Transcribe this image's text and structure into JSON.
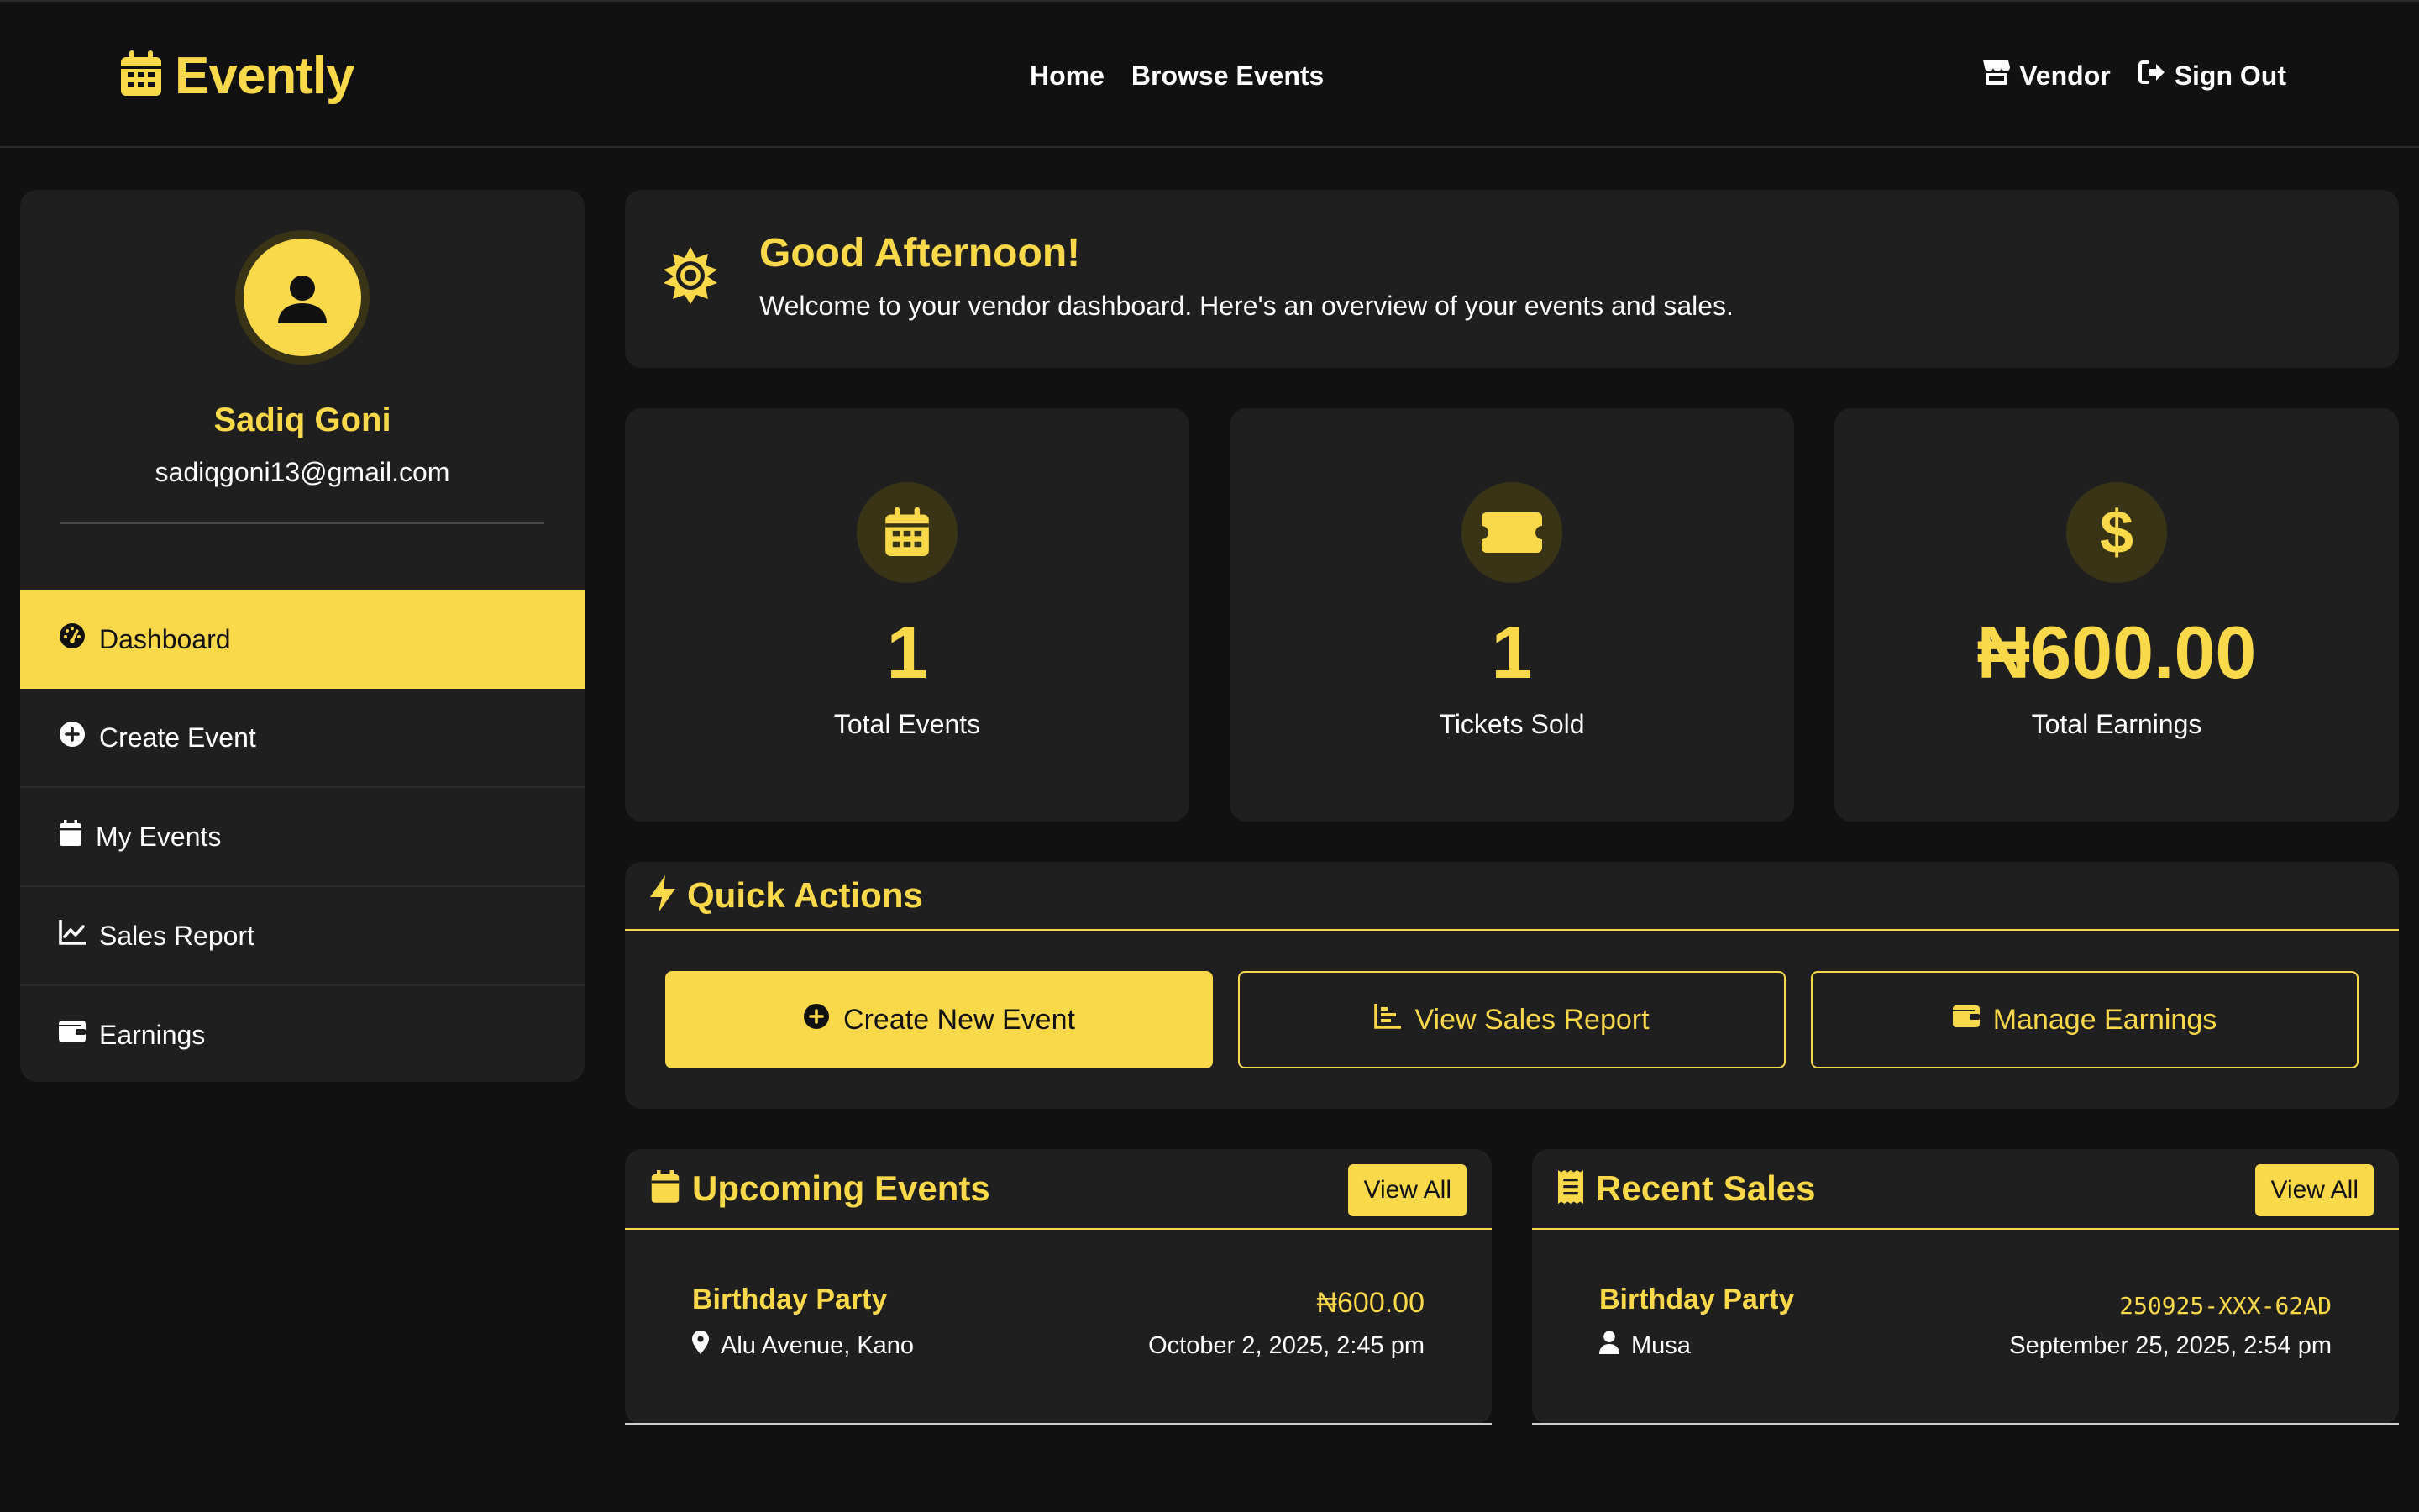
{
  "header": {
    "brand": "Evently",
    "nav": [
      {
        "label": "Home"
      },
      {
        "label": "Browse Events"
      }
    ],
    "right": [
      {
        "label": "Vendor",
        "icon": "store-icon"
      },
      {
        "label": "Sign Out",
        "icon": "sign-out-icon"
      }
    ]
  },
  "profile": {
    "name": "Sadiq Goni",
    "email": "sadiqgoni13@gmail.com"
  },
  "menu": [
    {
      "label": "Dashboard",
      "icon": "gauge-icon",
      "active": true
    },
    {
      "label": "Create Event",
      "icon": "plus-circle-icon",
      "active": false
    },
    {
      "label": "My Events",
      "icon": "calendar-icon",
      "active": false
    },
    {
      "label": "Sales Report",
      "icon": "line-chart-icon",
      "active": false
    },
    {
      "label": "Earnings",
      "icon": "wallet-icon",
      "active": false
    }
  ],
  "greeting": {
    "title": "Good Afternoon!",
    "subtitle": "Welcome to your vendor dashboard. Here's an overview of your events and sales."
  },
  "stats": [
    {
      "value": "1",
      "label": "Total Events",
      "icon": "calendar-icon"
    },
    {
      "value": "1",
      "label": "Tickets Sold",
      "icon": "ticket-icon"
    },
    {
      "value": "₦600.00",
      "label": "Total Earnings",
      "icon": "dollar-icon"
    }
  ],
  "quick_actions": {
    "title": "Quick Actions",
    "buttons": [
      {
        "label": "Create New Event",
        "icon": "plus-circle-icon"
      },
      {
        "label": "View Sales Report",
        "icon": "bar-chart-icon"
      },
      {
        "label": "Manage Earnings",
        "icon": "wallet-icon"
      }
    ]
  },
  "upcoming": {
    "title": "Upcoming Events",
    "view_all": "View All",
    "item": {
      "name": "Birthday Party",
      "location": "Alu Avenue, Kano",
      "price": "₦600.00",
      "date": "October 2, 2025, 2:45 pm"
    }
  },
  "recent_sales": {
    "title": "Recent Sales",
    "view_all": "View All",
    "item": {
      "name": "Birthday Party",
      "buyer": "Musa",
      "code": "250925-XXX-62AD",
      "date": "September 25, 2025, 2:54 pm"
    }
  },
  "colors": {
    "accent": "#f9d84a",
    "background": "#111111",
    "panel": "#1f1f1f"
  }
}
